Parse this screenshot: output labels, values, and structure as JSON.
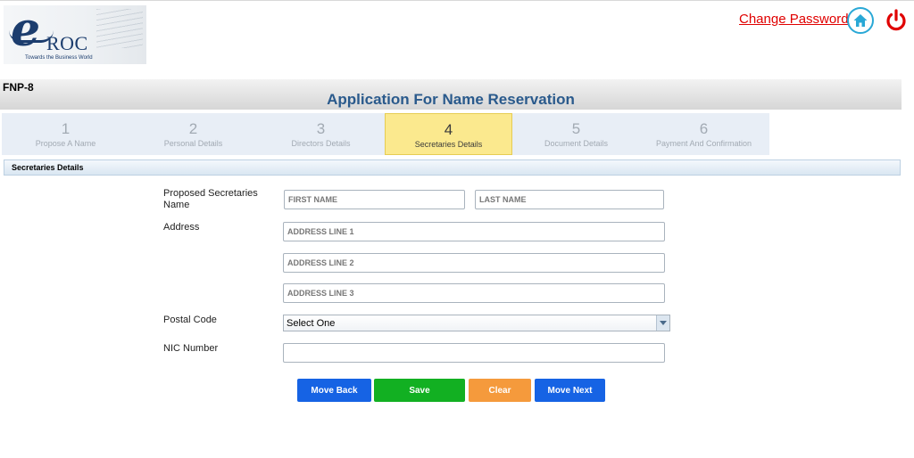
{
  "logo": {
    "letter": "e",
    "text": "ROC",
    "tagline": "Towards the Business World"
  },
  "header": {
    "change_password": "Change Password",
    "home_icon": "home-icon",
    "power_icon": "power-icon",
    "accent_color": "#29a8d6",
    "power_color": "#e00000"
  },
  "titlebar": {
    "form_code": "FNP-8",
    "title": "Application For Name Reservation"
  },
  "steps": [
    {
      "num": "1",
      "label": "Propose A Name"
    },
    {
      "num": "2",
      "label": "Personal Details"
    },
    {
      "num": "3",
      "label": "Directors Details"
    },
    {
      "num": "4",
      "label": "Secretaries Details"
    },
    {
      "num": "5",
      "label": "Document Details"
    },
    {
      "num": "6",
      "label": "Payment And Confirmation"
    }
  ],
  "active_step": "4",
  "section": {
    "title": "Secretaries Details"
  },
  "form": {
    "name_label": "Proposed Secretaries Name",
    "first_name_placeholder": "FIRST NAME",
    "last_name_placeholder": "LAST NAME",
    "address_label": "Address",
    "address1_placeholder": "ADDRESS LINE 1",
    "address2_placeholder": "ADDRESS LINE 2",
    "address3_placeholder": "ADDRESS LINE 3",
    "postal_label": "Postal Code",
    "postal_value": "Select One",
    "nic_label": "NIC Number",
    "nic_value": ""
  },
  "buttons": {
    "back": "Move Back",
    "save": "Save",
    "clear": "Clear",
    "next": "Move Next"
  },
  "colors": {
    "blue_button": "#1663e4",
    "green_button": "#12b022",
    "orange_button": "#f59a3c",
    "active_step": "#fbe98e",
    "title_text": "#2a5a8c"
  }
}
